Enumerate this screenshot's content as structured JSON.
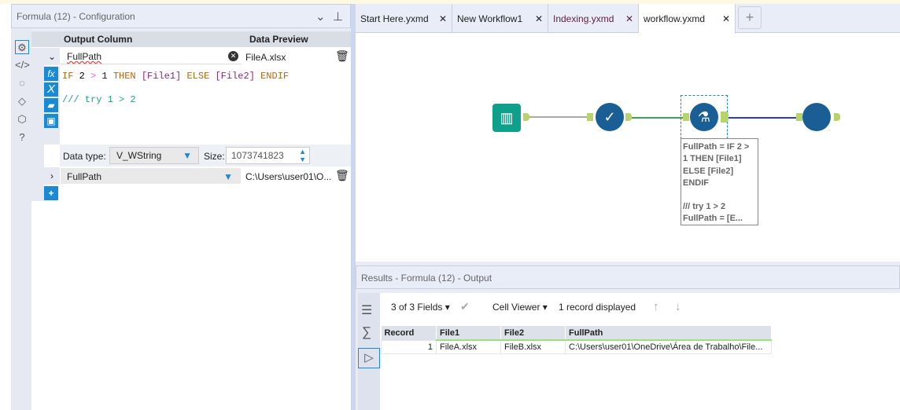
{
  "config": {
    "title": "Formula (12) - Configuration",
    "col_output": "Output Column",
    "col_preview": "Data Preview",
    "row1": {
      "field": "FullPath",
      "preview": "FileA.xlsx"
    },
    "code": {
      "if": "IF",
      "n2": "2",
      "gt": ">",
      "n1": "1",
      "then": "THEN",
      "f1": "[File1]",
      "else": "ELSE",
      "f2": "[File2]",
      "endif": "ENDIF",
      "comment": "/// try 1 > 2"
    },
    "datatype_label": "Data type:",
    "datatype": "V_WString",
    "size_label": "Size:",
    "size": "1073741823",
    "row2": {
      "field": "FullPath",
      "preview": "C:\\Users\\user01\\O..."
    },
    "add": "+"
  },
  "tabs": [
    {
      "label": "Start Here.yxmd"
    },
    {
      "label": "New Workflow1"
    },
    {
      "label": "Indexing.yxmd"
    },
    {
      "label": "workflow.yxmd",
      "active": true
    }
  ],
  "annotation": [
    "FullPath = IF 2 >",
    "1 THEN [File1]",
    "ELSE [File2]",
    "ENDIF",
    "",
    "/// try 1 > 2",
    "FullPath = [E..."
  ],
  "results": {
    "title": "Results - Formula (12) - Output",
    "fields": "3 of 3 Fields",
    "viewer": "Cell Viewer",
    "records": "1 record displayed",
    "columns": [
      "Record",
      "File1",
      "File2",
      "FullPath"
    ],
    "rows": [
      [
        "1",
        "FileA.xlsx",
        "FileB.xlsx",
        "C:\\Users\\user01\\OneDrive\\Área de Trabalho\\File..."
      ]
    ]
  },
  "colors": {
    "accent": "#1a8ad4",
    "node": "#1a5e96",
    "input": "#0fa08c",
    "anchor": "#b7d36b"
  }
}
